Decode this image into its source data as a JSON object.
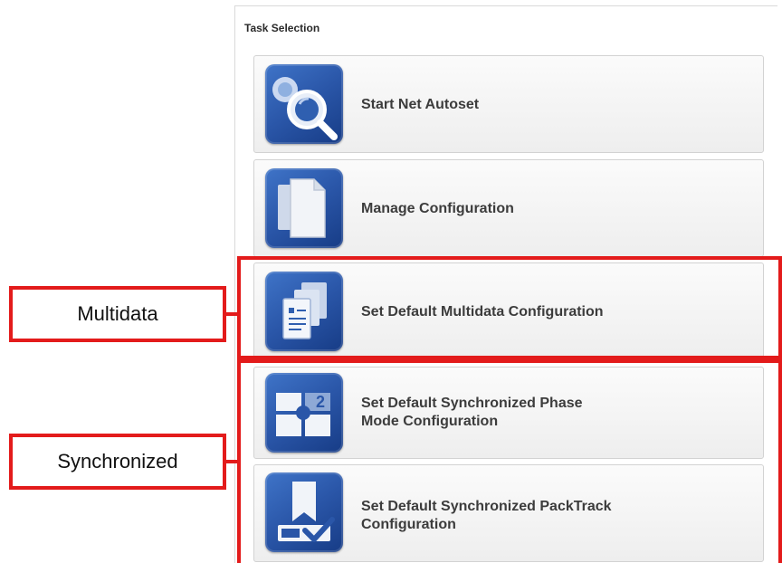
{
  "panel": {
    "title": "Task Selection",
    "tasks": [
      {
        "id": "start-net-autoset",
        "icon": "magnifier-icon",
        "lines": [
          "Start Net Autoset"
        ]
      },
      {
        "id": "manage-configuration",
        "icon": "documents-icon",
        "lines": [
          "Manage Configuration"
        ]
      },
      {
        "id": "multidata-configuration",
        "icon": "stacked-documents-icon",
        "lines": [
          "Set Default Multidata Configuration"
        ]
      },
      {
        "id": "synchronized-phase",
        "icon": "phase-mode-icon",
        "lines": [
          "Set Default Synchronized Phase",
          "Mode Configuration"
        ]
      },
      {
        "id": "synchronized-packtrack",
        "icon": "packtrack-icon",
        "lines": [
          "Set Default Synchronized PackTrack",
          "Configuration"
        ]
      }
    ]
  },
  "annotations": {
    "multidata_label": "Multidata",
    "synchronized_label": "Synchronized",
    "highlight_color": "#e31b1b"
  },
  "icon_badge_number": "2"
}
